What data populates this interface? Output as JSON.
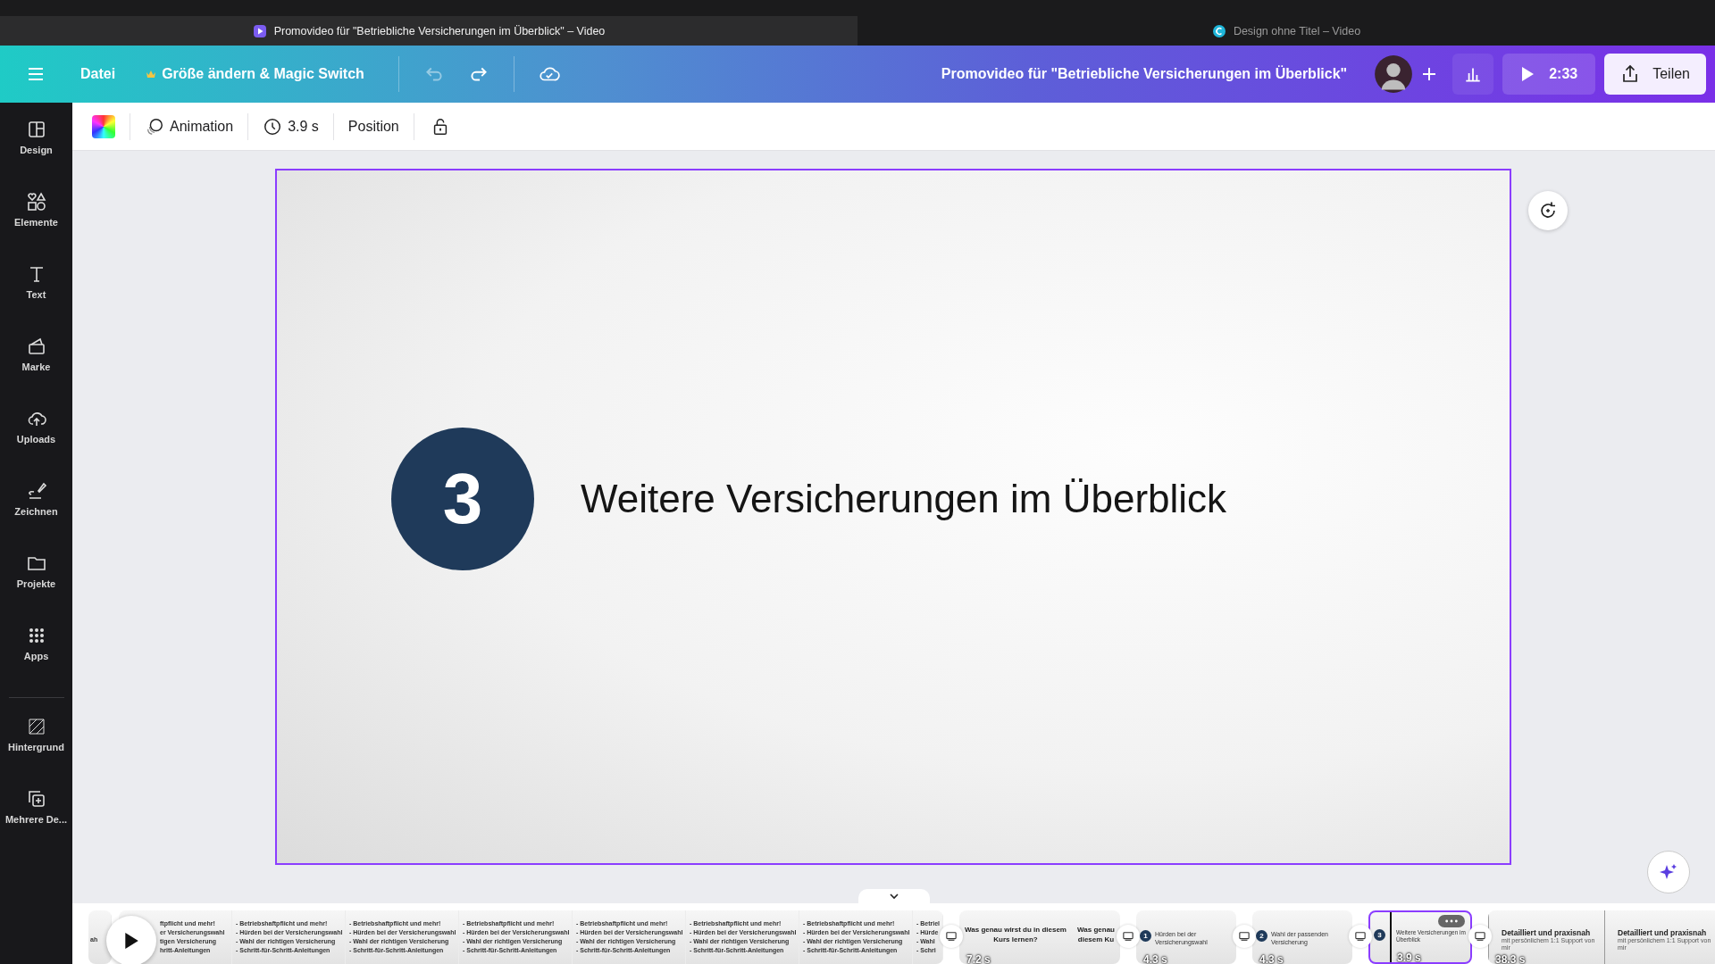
{
  "browser_tabs": [
    {
      "title": "Promovideo für \"Betriebliche Versicherungen im Überblick\" – Video",
      "selected": true
    },
    {
      "title": "Design ohne Titel – Video",
      "selected": false
    }
  ],
  "top_bar": {
    "file_menu": "Datei",
    "resize": "Größe ändern & Magic Switch",
    "title": "Promovideo für \"Betriebliche Versicherungen im Überblick\"",
    "play_time": "2:33",
    "share": "Teilen"
  },
  "toolbar": {
    "animation": "Animation",
    "duration": "3.9 s",
    "position": "Position"
  },
  "sidebar": {
    "items": [
      {
        "label": "Design"
      },
      {
        "label": "Elemente"
      },
      {
        "label": "Text"
      },
      {
        "label": "Marke"
      },
      {
        "label": "Uploads"
      },
      {
        "label": "Zeichnen"
      },
      {
        "label": "Projekte"
      },
      {
        "label": "Apps"
      },
      {
        "label": "Hintergrund"
      },
      {
        "label": "Mehrere De..."
      }
    ]
  },
  "canvas": {
    "number": "3",
    "heading": "Weitere Versicherungen im Überblick"
  },
  "timeline": {
    "clips": [
      {
        "kind": "list",
        "selected": false,
        "frames": [
          {
            "lines": [
              "ah"
            ]
          }
        ]
      },
      {
        "kind": "list",
        "selected": false,
        "frames": [
          {
            "lines": [
              "ftpflicht und mehr!",
              "er Versicherungswahl",
              "tigen Versicherung",
              "hritt-Anleitungen"
            ]
          },
          {
            "lines": [
              "- Betriebshaftpflicht und mehr!",
              "- Hürden bei der Versicherungswahl",
              "- Wahl der richtigen Versicherung",
              "- Schritt-für-Schritt-Anleitungen"
            ]
          },
          {
            "lines": [
              "- Betriebshaftpflicht und mehr!",
              "- Hürden bei der Versicherungswahl",
              "- Wahl der richtigen Versicherung",
              "- Schritt-für-Schritt-Anleitungen"
            ]
          },
          {
            "lines": [
              "- Betriebshaftpflicht und mehr!",
              "- Hürden bei der Versicherungswahl",
              "- Wahl der richtigen Versicherung",
              "- Schritt-für-Schritt-Anleitungen"
            ]
          },
          {
            "lines": [
              "- Betriebshaftpflicht und mehr!",
              "- Hürden bei der Versicherungswahl",
              "- Wahl der richtigen Versicherung",
              "- Schritt-für-Schritt-Anleitungen"
            ]
          },
          {
            "lines": [
              "- Betriebshaftpflicht und mehr!",
              "- Hürden bei der Versicherungswahl",
              "- Wahl der richtigen Versicherung",
              "- Schritt-für-Schritt-Anleitungen"
            ]
          },
          {
            "lines": [
              "- Betriebshaftpflicht und mehr!",
              "- Hürden bei der Versicherungswahl",
              "- Wahl der richtigen Versicherung",
              "- Schritt-für-Schritt-Anleitungen"
            ]
          },
          {
            "lines": [
              "- Betriel",
              "- Hürde",
              "- Wahl",
              "- Schri"
            ]
          }
        ]
      },
      {
        "kind": "title",
        "selected": false,
        "duration": "7.2 s",
        "frames": [
          {
            "lines": [
              "Was genau wirst du in diesem Kurs lernen?"
            ]
          },
          {
            "lines": [
              "Was genau",
              "diesem Ku"
            ]
          }
        ]
      },
      {
        "kind": "numbered",
        "selected": false,
        "duration": "4.3 s",
        "frames": [
          {
            "number": "1",
            "lines": [
              "Hürden bei der Versicherungswahl"
            ]
          }
        ]
      },
      {
        "kind": "numbered",
        "selected": false,
        "duration": "4.3 s",
        "frames": [
          {
            "number": "2",
            "lines": [
              "Wahl der passenden Versicherung"
            ]
          }
        ]
      },
      {
        "kind": "numbered",
        "selected": true,
        "duration": "3.9 s",
        "frames": [
          {
            "number": "3",
            "lines": [
              "Weitere Versicherungen im Überblick"
            ]
          }
        ]
      },
      {
        "kind": "heading",
        "selected": false,
        "duration": "38.3 s",
        "frames": [
          {
            "lines": [
              "Detailliert und praxisnah",
              "mit persönlichem 1:1 Support von mir"
            ]
          },
          {
            "lines": [
              "Detailliert und praxisnah",
              "mit persönlichem 1:1 Support von mir"
            ]
          }
        ]
      }
    ]
  }
}
